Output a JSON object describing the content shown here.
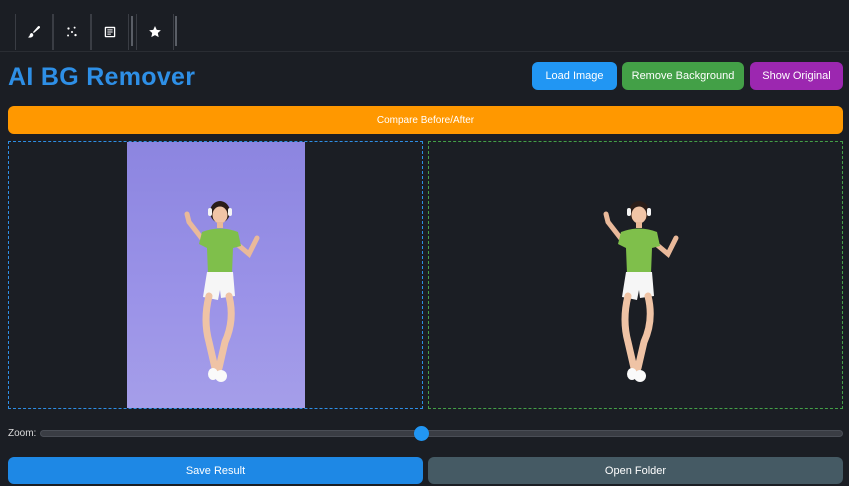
{
  "toolbar": {
    "tools": [
      {
        "icon": "brush-icon"
      },
      {
        "icon": "sparkle-dots-icon"
      },
      {
        "icon": "notes-icon"
      },
      {
        "icon": "star-icon"
      }
    ]
  },
  "app": {
    "title": "AI BG Remover"
  },
  "actions": {
    "load_label": "Load Image",
    "remove_label": "Remove Background",
    "original_label": "Show Original",
    "compare_label": "Compare Before/After"
  },
  "zoom": {
    "label": "Zoom:",
    "value": 0.475
  },
  "footer": {
    "save_label": "Save Result",
    "folder_label": "Open Folder"
  },
  "colors": {
    "accent_title": "#2e8fe6",
    "load": "#2196f3",
    "remove": "#43a047",
    "original": "#9c27b0",
    "compare": "#ff9800",
    "save": "#1e88e5",
    "folder": "#455a64"
  }
}
